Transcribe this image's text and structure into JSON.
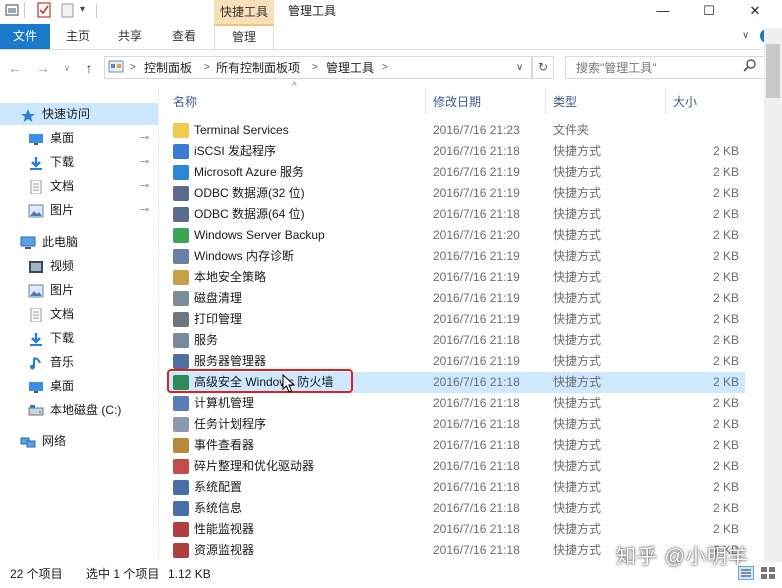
{
  "window": {
    "title": "管理工具",
    "context_group": "快捷工具",
    "minimize": "—",
    "maximize": "☐",
    "close": "✕",
    "help": "?",
    "expand": "∨"
  },
  "ribbon": {
    "tabs": [
      "文件",
      "主页",
      "共享",
      "查看",
      "管理"
    ]
  },
  "address": {
    "back": "←",
    "forward": "→",
    "recent": "∨",
    "up": "↑",
    "breadcrumbs": [
      "控制面板",
      "所有控制面板项",
      "管理工具"
    ],
    "sep": ">",
    "dropdown": "∨",
    "refresh": "↻"
  },
  "search": {
    "placeholder": "搜索\"管理工具\""
  },
  "nav": {
    "quick_access": "快速访问",
    "pin": "📌",
    "items": [
      {
        "label": "桌面"
      },
      {
        "label": "下载"
      },
      {
        "label": "文档"
      },
      {
        "label": "图片"
      }
    ],
    "this_pc": "此电脑",
    "pc_items": [
      {
        "label": "视频"
      },
      {
        "label": "图片"
      },
      {
        "label": "文档"
      },
      {
        "label": "下载"
      },
      {
        "label": "音乐"
      },
      {
        "label": "桌面"
      },
      {
        "label": "本地磁盘 (C:)"
      }
    ],
    "network": "网络"
  },
  "columns": {
    "name": "名称",
    "date": "修改日期",
    "type": "类型",
    "size": "大小",
    "sort_arrow": "^"
  },
  "files": [
    {
      "name": "Terminal Services",
      "date": "2016/7/16 21:23",
      "type": "文件夹",
      "size": "",
      "icon": "folder-icon",
      "color": "#f2c94c"
    },
    {
      "name": "iSCSI 发起程序",
      "date": "2016/7/16 21:18",
      "type": "快捷方式",
      "size": "2 KB",
      "icon": "iscsi-icon",
      "color": "#3a7bd5"
    },
    {
      "name": "Microsoft Azure 服务",
      "date": "2016/7/16 21:19",
      "type": "快捷方式",
      "size": "2 KB",
      "icon": "azure-icon",
      "color": "#2b88d8"
    },
    {
      "name": "ODBC 数据源(32 位)",
      "date": "2016/7/16 21:19",
      "type": "快捷方式",
      "size": "2 KB",
      "icon": "odbc-icon",
      "color": "#5b6b8c"
    },
    {
      "name": "ODBC 数据源(64 位)",
      "date": "2016/7/16 21:18",
      "type": "快捷方式",
      "size": "2 KB",
      "icon": "odbc-icon",
      "color": "#5b6b8c"
    },
    {
      "name": "Windows Server Backup",
      "date": "2016/7/16 21:20",
      "type": "快捷方式",
      "size": "2 KB",
      "icon": "backup-icon",
      "color": "#3aa655"
    },
    {
      "name": "Windows 内存诊断",
      "date": "2016/7/16 21:19",
      "type": "快捷方式",
      "size": "2 KB",
      "icon": "memory-icon",
      "color": "#6a7fa6"
    },
    {
      "name": "本地安全策略",
      "date": "2016/7/16 21:19",
      "type": "快捷方式",
      "size": "2 KB",
      "icon": "security-policy-icon",
      "color": "#c8a04a"
    },
    {
      "name": "磁盘清理",
      "date": "2016/7/16 21:19",
      "type": "快捷方式",
      "size": "2 KB",
      "icon": "disk-cleanup-icon",
      "color": "#7d8c99"
    },
    {
      "name": "打印管理",
      "date": "2016/7/16 21:19",
      "type": "快捷方式",
      "size": "2 KB",
      "icon": "printer-icon",
      "color": "#6e7780"
    },
    {
      "name": "服务",
      "date": "2016/7/16 21:18",
      "type": "快捷方式",
      "size": "2 KB",
      "icon": "services-icon",
      "color": "#7a8a9a"
    },
    {
      "name": "服务器管理器",
      "date": "2016/7/16 21:19",
      "type": "快捷方式",
      "size": "2 KB",
      "icon": "server-manager-icon",
      "color": "#4f6f9f"
    },
    {
      "name": "高级安全 Windows 防火墙",
      "date": "2016/7/16 21:18",
      "type": "快捷方式",
      "size": "2 KB",
      "icon": "firewall-icon",
      "color": "#2e8b57"
    },
    {
      "name": "计算机管理",
      "date": "2016/7/16 21:18",
      "type": "快捷方式",
      "size": "2 KB",
      "icon": "computer-management-icon",
      "color": "#5a7db5"
    },
    {
      "name": "任务计划程序",
      "date": "2016/7/16 21:18",
      "type": "快捷方式",
      "size": "2 KB",
      "icon": "task-scheduler-icon",
      "color": "#8a9bb0"
    },
    {
      "name": "事件查看器",
      "date": "2016/7/16 21:18",
      "type": "快捷方式",
      "size": "2 KB",
      "icon": "event-viewer-icon",
      "color": "#b58a3c"
    },
    {
      "name": "碎片整理和优化驱动器",
      "date": "2016/7/16 21:18",
      "type": "快捷方式",
      "size": "2 KB",
      "icon": "defrag-icon",
      "color": "#c24b4b"
    },
    {
      "name": "系统配置",
      "date": "2016/7/16 21:18",
      "type": "快捷方式",
      "size": "2 KB",
      "icon": "system-config-icon",
      "color": "#4a6fa8"
    },
    {
      "name": "系统信息",
      "date": "2016/7/16 21:18",
      "type": "快捷方式",
      "size": "2 KB",
      "icon": "system-info-icon",
      "color": "#4a6fa8"
    },
    {
      "name": "性能监视器",
      "date": "2016/7/16 21:18",
      "type": "快捷方式",
      "size": "2 KB",
      "icon": "performance-icon",
      "color": "#b04040"
    },
    {
      "name": "资源监视器",
      "date": "2016/7/16 21:18",
      "type": "快捷方式",
      "size": "2 KB",
      "icon": "resource-monitor-icon",
      "color": "#b04040"
    }
  ],
  "status": {
    "count": "22 个项目",
    "selected": "选中 1 个项目",
    "size": "1.12 KB"
  },
  "watermark": "知乎 @小明羊",
  "colors": {
    "accent": "#1979ca",
    "selection": "#cde8ff",
    "highlight_box": "#e02020"
  }
}
